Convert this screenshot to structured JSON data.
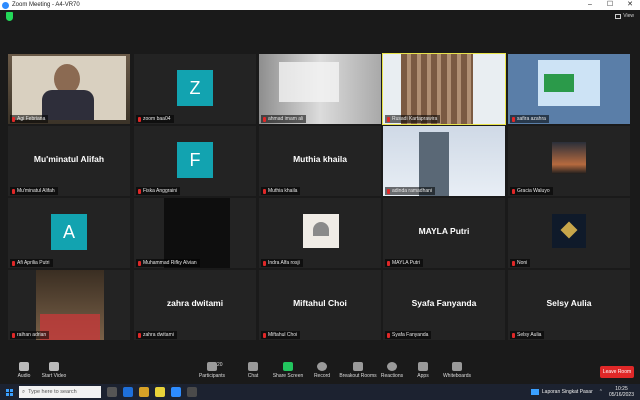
{
  "window": {
    "title": "Zoom Meeting - A4-VR70",
    "min": "–",
    "max": "☐",
    "close": "✕"
  },
  "topbar": {
    "view_label": "View"
  },
  "participants": [
    {
      "name": "Agi Febriana",
      "display": "",
      "type": "video-boy"
    },
    {
      "name": "zoom baa04",
      "display": "",
      "type": "avatar",
      "letter": "Z",
      "color": "#12a3b0"
    },
    {
      "name": "ahmad imam ali",
      "display": "",
      "type": "video-room"
    },
    {
      "name": "Rusadi Kartaprawira",
      "display": "",
      "type": "video-curtain"
    },
    {
      "name": "safira azahra",
      "display": "",
      "type": "video-screen"
    },
    {
      "name": "Mu'minatul Alifah",
      "display": "Mu'minatul Alifah",
      "type": "name"
    },
    {
      "name": "Fiska Anggraini",
      "display": "",
      "type": "avatar",
      "letter": "F",
      "color": "#12a3b0"
    },
    {
      "name": "Muthia khaila",
      "display": "Muthia khaila",
      "type": "name"
    },
    {
      "name": "adinda ramadhani",
      "display": "",
      "type": "video-building"
    },
    {
      "name": "Gracia Waluyo",
      "display": "",
      "type": "video-sunset"
    },
    {
      "name": "Afi Aprilia Putri",
      "display": "",
      "type": "avatar",
      "letter": "A",
      "color": "#12a3b0"
    },
    {
      "name": "Muhammad Rifky Alvian",
      "display": "",
      "type": "video-dark"
    },
    {
      "name": "Indra Alfa rosji",
      "display": "",
      "type": "video-mosque"
    },
    {
      "name": "MAYLA Putri",
      "display": "MAYLA Putri",
      "type": "name"
    },
    {
      "name": "Noni",
      "display": "",
      "type": "video-space"
    },
    {
      "name": "raihan adrian",
      "display": "",
      "type": "video-group"
    },
    {
      "name": "zahra dwitami",
      "display": "zahra dwitami",
      "type": "name"
    },
    {
      "name": "Miftahul Choi",
      "display": "Miftahul Choi",
      "type": "name"
    },
    {
      "name": "Syafa Fanyanda",
      "display": "Syafa Fanyanda",
      "type": "name"
    },
    {
      "name": "Selsy Aulia",
      "display": "Selsy Aulia",
      "type": "name"
    }
  ],
  "toolbar": {
    "audio": "Audio",
    "start_video": "Start Video",
    "participants": "Participants",
    "participants_count": "20",
    "chat": "Chat",
    "share_screen": "Share Screen",
    "record": "Record",
    "breakout_rooms": "Breakout Rooms",
    "reactions": "Reactions",
    "apps": "Apps",
    "whiteboards": "Whiteboards",
    "leave": "Leave Room"
  },
  "taskbar": {
    "search_placeholder": "Type here to search",
    "news": "Laporan Singkat Pasar",
    "time": "10:25",
    "date": "05/16/2023"
  },
  "colors": {
    "accent_green": "#22c55e",
    "leave_red": "#e02828",
    "avatar_teal": "#12a3b0",
    "active_border": "#e8e34a"
  }
}
